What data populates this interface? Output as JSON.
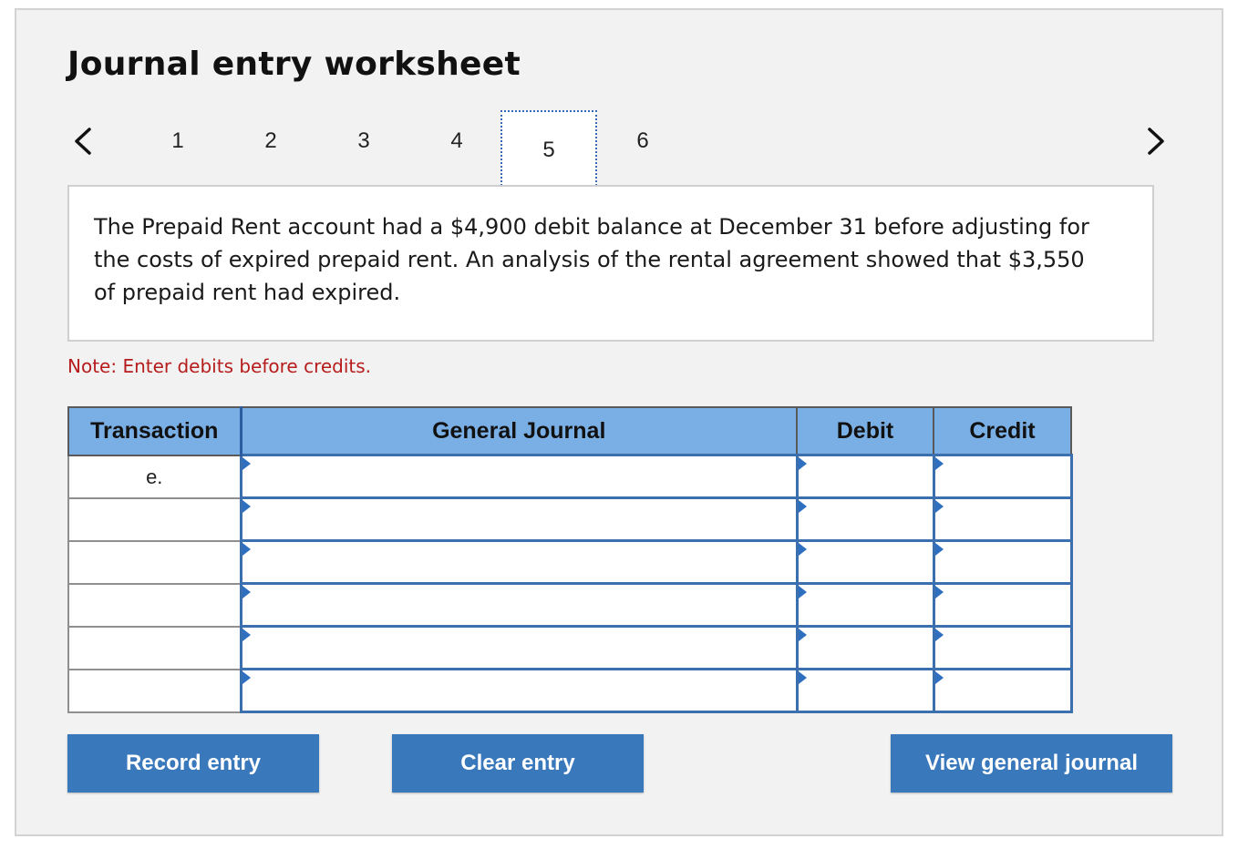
{
  "title": "Journal entry worksheet",
  "pagination": {
    "prev_icon": "chevron-left-icon",
    "next_icon": "chevron-right-icon",
    "pages": [
      "1",
      "2",
      "3",
      "4",
      "5",
      "6"
    ],
    "current": "5"
  },
  "question": "The Prepaid Rent account had a $4,900 debit balance at December 31 before adjusting for the costs of expired prepaid rent. An analysis of the rental agreement showed that $3,550 of prepaid rent had expired.",
  "note": "Note: Enter debits before credits.",
  "journal": {
    "headers": {
      "transaction": "Transaction",
      "general_journal": "General Journal",
      "debit": "Debit",
      "credit": "Credit"
    },
    "rows": [
      {
        "transaction": "e.",
        "account": "",
        "debit": "",
        "credit": ""
      },
      {
        "transaction": "",
        "account": "",
        "debit": "",
        "credit": ""
      },
      {
        "transaction": "",
        "account": "",
        "debit": "",
        "credit": ""
      },
      {
        "transaction": "",
        "account": "",
        "debit": "",
        "credit": ""
      },
      {
        "transaction": "",
        "account": "",
        "debit": "",
        "credit": ""
      },
      {
        "transaction": "",
        "account": "",
        "debit": "",
        "credit": ""
      }
    ]
  },
  "buttons": {
    "record": "Record entry",
    "clear": "Clear entry",
    "view": "View general journal"
  },
  "colors": {
    "header_bg": "#7aafe5",
    "button_bg": "#3a78bc",
    "note_red": "#b71c1c",
    "input_border": "#3c6fae"
  }
}
